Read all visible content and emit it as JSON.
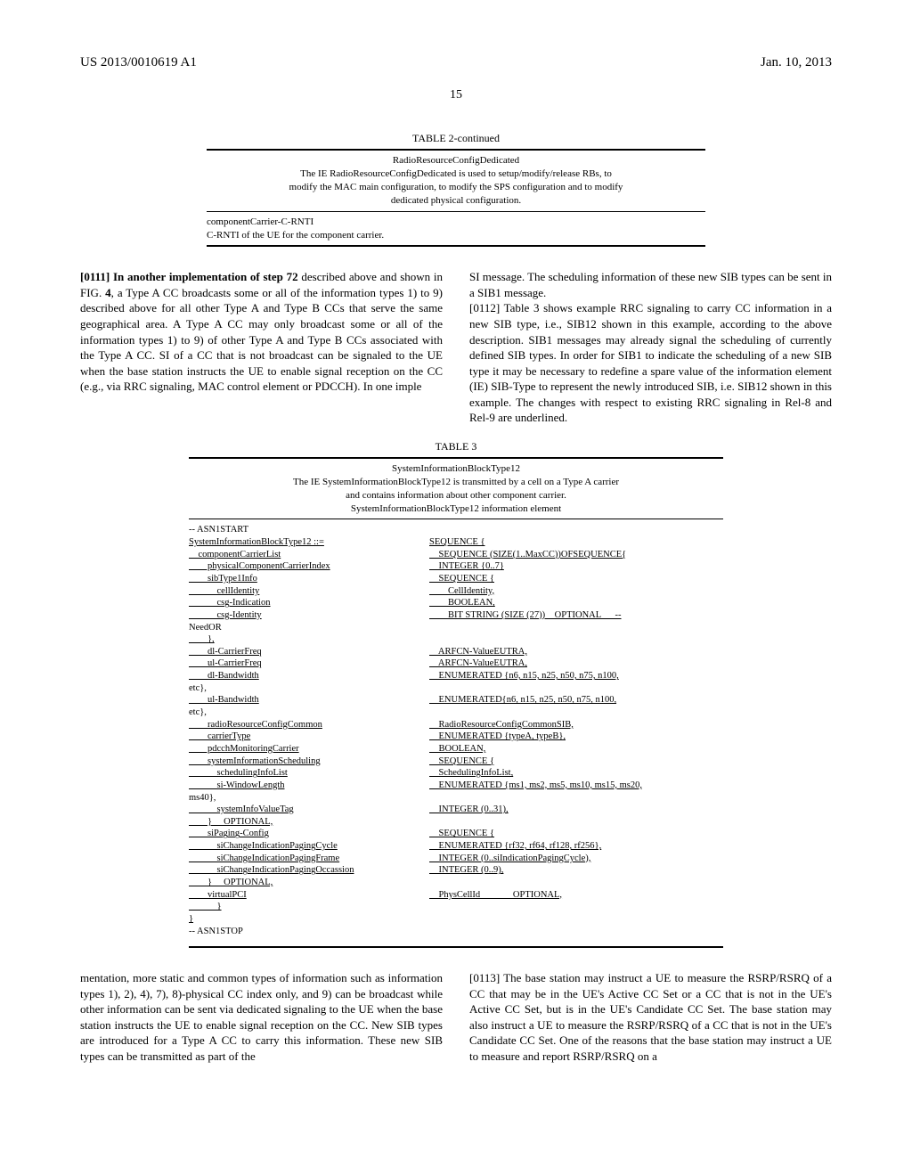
{
  "header": {
    "patent_number": "US 2013/0010619 A1",
    "date": "Jan. 10, 2013",
    "page_number": "15"
  },
  "table2": {
    "caption": "TABLE 2-continued",
    "header_lines": [
      "RadioResourceConfigDedicated",
      "The IE RadioResourceConfigDedicated is used to setup/modify/release RBs, to",
      "modify the MAC main configuration, to modify the SPS configuration and to modify",
      "dedicated physical configuration."
    ],
    "body_lines": [
      "componentCarrier-C-RNTI",
      "C-RNTI of the UE for the component carrier."
    ]
  },
  "paragraphs": {
    "p0111a": "[0111]   In another implementation of step ",
    "p0111_stepref": "72",
    "p0111b": " described above and shown in FIG. ",
    "p0111_figref": "4",
    "p0111c": ", a Type A CC broadcasts some or all of the information types 1) to 9) described above for all other Type A and Type B CCs that serve the same geographical area. A Type A CC may only broadcast some or all of the information types 1) to 9) of other Type A and Type B CCs associated with the Type A CC. SI of a CC that is not broadcast can be signaled to the UE when the base station instructs the UE to enable signal reception on the CC (e.g., via RRC signaling, MAC control element or PDCCH). In one imple",
    "p0111d": "SI message. The scheduling information of these new SIB types can be sent in a SIB1 message.",
    "p0112": "[0112]   Table 3 shows example RRC signaling to carry CC information in a new SIB type, i.e., SIB12 shown in this example, according to the above description. SIB1 messages may already signal the scheduling of currently defined SIB types. In order for SIB1 to indicate the scheduling of a new SIB type it may be necessary to redefine a spare value of the information element (IE) SIB-Type to represent the newly introduced SIB, i.e. SIB12 shown in this example. The changes with respect to existing RRC signaling in Rel-8 and Rel-9 are underlined."
  },
  "table3": {
    "caption": "TABLE 3",
    "header_lines": [
      "SystemInformationBlockType12",
      "The IE SystemInformationBlockType12 is transmitted by a cell on a Type A carrier",
      "and contains information about other component carrier.",
      "SystemInformationBlockType12 information element"
    ],
    "asn1": [
      {
        "l": "-- ASN1START",
        "r": ""
      },
      {
        "l": "SystemInformationBlockType12 ::=",
        "r": "SEQUENCE {",
        "u": true
      },
      {
        "l": "    componentCarrierList",
        "r": "    SEQUENCE (SIZE(1..MaxCC))OFSEQUENCE{",
        "u": true
      },
      {
        "l": "        physicalComponentCarrierIndex",
        "r": "    INTEGER {0..7}",
        "u": true
      },
      {
        "l": "        sibType1Info",
        "r": "    SEQUENCE {",
        "u": true
      },
      {
        "l": "            cellIdentity",
        "r": "        CellIdentity,",
        "u": true
      },
      {
        "l": "            csg-Indication",
        "r": "        BOOLEAN,",
        "u": true
      },
      {
        "l": "            csg-Identity",
        "r": "        BIT STRING (SIZE (27))    OPTIONAL      --",
        "u": true
      },
      {
        "l": "NeedOR",
        "r": ""
      },
      {
        "l": "        },",
        "r": "",
        "u": true
      },
      {
        "l": "        dl-CarrierFreq",
        "r": "    ARFCN-ValueEUTRA,",
        "u": true
      },
      {
        "l": "        ul-CarrierFreq",
        "r": "    ARFCN-ValueEUTRA,",
        "u": true
      },
      {
        "l": "        dl-Bandwidth",
        "r": "    ENUMERATED {n6, n15, n25, n50, n75, n100,",
        "u": true
      },
      {
        "l": "etc},",
        "r": ""
      },
      {
        "l": "        ul-Bandwidth",
        "r": "    ENUMERATED{n6, n15, n25, n50, n75, n100,",
        "u": true
      },
      {
        "l": "etc},",
        "r": ""
      },
      {
        "l": "        radioResourceConfigCommon",
        "r": "    RadioResourceConfigCommonSIB,",
        "u": true
      },
      {
        "l": "        carrierType",
        "r": "    ENUMERATED {typeA, typeB},",
        "u": true
      },
      {
        "l": "        pdcchMonitoringCarrier",
        "r": "    BOOLEAN,",
        "u": true
      },
      {
        "l": "        systemInformationScheduling",
        "r": "    SEQUENCE {",
        "u": true
      },
      {
        "l": "            schedulingInfoList",
        "r": "    SchedulingInfoList,",
        "u": true
      },
      {
        "l": "            si-WindowLength",
        "r": "    ENUMERATED {ms1, ms2, ms5, ms10, ms15, ms20,",
        "u": true
      },
      {
        "l": "ms40},",
        "r": ""
      },
      {
        "l": "            systemInfoValueTag",
        "r": "    INTEGER (0..31),",
        "u": true
      },
      {
        "l": "        }     OPTIONAL,",
        "r": "",
        "u": true
      },
      {
        "l": "        siPaging-Config",
        "r": "    SEQUENCE {",
        "u": true
      },
      {
        "l": "            siChangeIndicationPagingCycle",
        "r": "    ENUMERATED {rf32, rf64, rf128, rf256},",
        "u": true
      },
      {
        "l": "            siChangeIndicationPagingFrame",
        "r": "    INTEGER (0..siIndicationPagingCycle),",
        "u": true
      },
      {
        "l": "            siChangeIndicationPagingOccassion",
        "r": "    INTEGER (0..9),",
        "u": true
      },
      {
        "l": "        }     OPTIONAL,",
        "r": "",
        "u": true
      },
      {
        "l": "        virtualPCI",
        "r": "    PhysCellId              OPTIONAL,",
        "u": true
      },
      {
        "l": "            }",
        "r": "",
        "u": true
      },
      {
        "l": "}",
        "r": "",
        "u": true
      },
      {
        "l": "-- ASN1STOP",
        "r": ""
      }
    ]
  },
  "bottom_paragraphs": {
    "p_cont": "mentation, more static and common types of information such as information types 1), 2), 4), 7), 8)-physical CC index only, and 9) can be broadcast while other information can be sent via dedicated signaling to the UE when the base station instructs the UE to enable signal reception on the CC. New SIB types are introduced for a Type A CC to carry this information. These new SIB types can be transmitted as part of the",
    "p0113": "[0113]   The base station may instruct a UE to measure the RSRP/RSRQ of a CC that may be in the UE's Active CC Set or a CC that is not in the UE's Active CC Set, but is in the UE's Candidate CC Set. The base station may also instruct a UE to measure the RSRP/RSRQ of a CC that is not in the UE's Candidate CC Set. One of the reasons that the base station may instruct a UE to measure and report RSRP/RSRQ on a"
  }
}
